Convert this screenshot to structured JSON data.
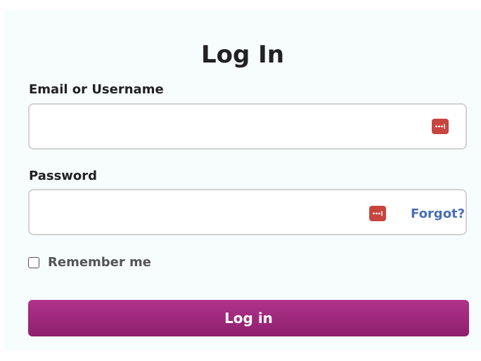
{
  "form": {
    "title": "Log In",
    "email": {
      "label": "Email or Username",
      "value": "",
      "placeholder": ""
    },
    "password": {
      "label": "Password",
      "value": "",
      "placeholder": "",
      "forgot_label": "Forgot?"
    },
    "remember": {
      "label": "Remember me",
      "checked": false
    },
    "submit_label": "Log in"
  },
  "icons": {
    "password_manager": "password-manager-icon"
  },
  "colors": {
    "accent": "#a02a7e",
    "link": "#4a6fb5",
    "password_manager_icon": "#c8453f",
    "panel_background": "#f7fcfd"
  }
}
